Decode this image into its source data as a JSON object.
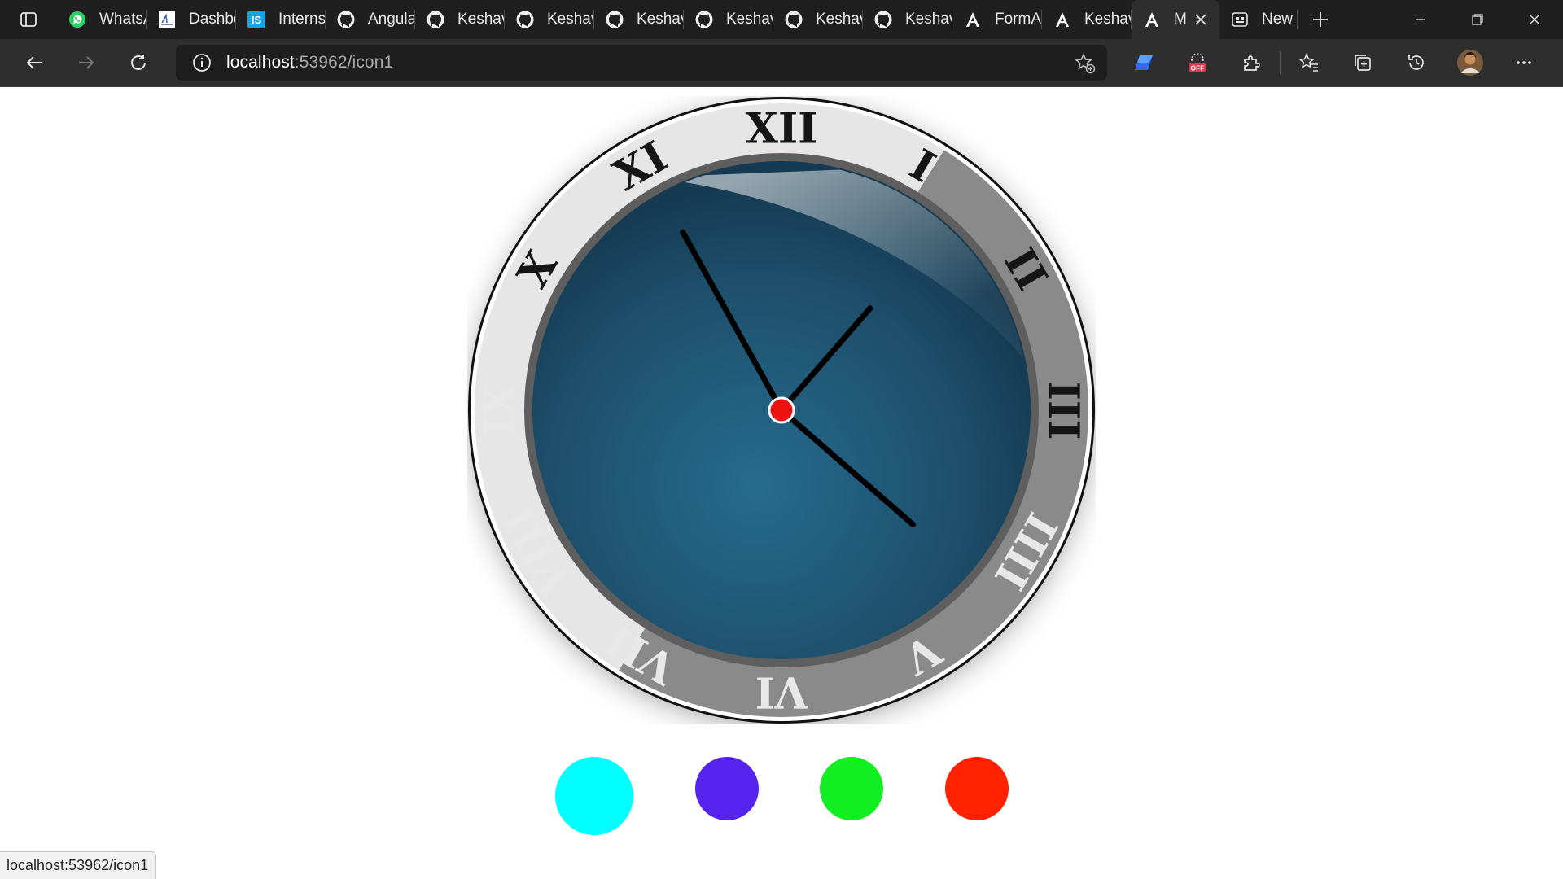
{
  "browser": {
    "tabs": [
      {
        "label": "WhatsApp",
        "icon": "whatsapp-icon"
      },
      {
        "label": "Dashboard",
        "icon": "dashboard-favicon"
      },
      {
        "label": "Internshala",
        "icon": "internshala-icon"
      },
      {
        "label": "Angular",
        "icon": "github-icon"
      },
      {
        "label": "Keshav",
        "icon": "github-icon"
      },
      {
        "label": "Keshav",
        "icon": "github-icon"
      },
      {
        "label": "Keshav",
        "icon": "github-icon"
      },
      {
        "label": "Keshav",
        "icon": "github-icon"
      },
      {
        "label": "Keshav",
        "icon": "github-icon"
      },
      {
        "label": "Keshav",
        "icon": "github-icon"
      },
      {
        "label": "FormA",
        "icon": "angular-icon"
      },
      {
        "label": "Keshav",
        "icon": "angular-icon"
      }
    ],
    "active_tab": {
      "label": "M",
      "icon": "angular-icon"
    },
    "new_tab": {
      "label": "New tab",
      "icon": "newtab-page-icon"
    },
    "url": {
      "host": "localhost",
      "path": ":53962/icon1"
    },
    "status_text": "localhost:53962/icon1"
  },
  "clock": {
    "numerals": [
      "XII",
      "I",
      "II",
      "III",
      "IIII",
      "V",
      "VI",
      "VII",
      "VIII",
      "IX",
      "X",
      "XI"
    ],
    "hands": {
      "hour_deg": 41,
      "minute_deg": 131,
      "second_deg": 331
    },
    "colors": {
      "face": "#1d4e6a",
      "bezel_light": "#e6e6e6",
      "bezel_dark": "#8a8a8a",
      "hands": "#000000",
      "center": "#ee1111"
    }
  },
  "color_buttons": [
    {
      "name": "cyan",
      "color": "#00ffff"
    },
    {
      "name": "violet",
      "color": "#5522ee"
    },
    {
      "name": "green",
      "color": "#11ee22"
    },
    {
      "name": "red",
      "color": "#ff2200"
    }
  ]
}
